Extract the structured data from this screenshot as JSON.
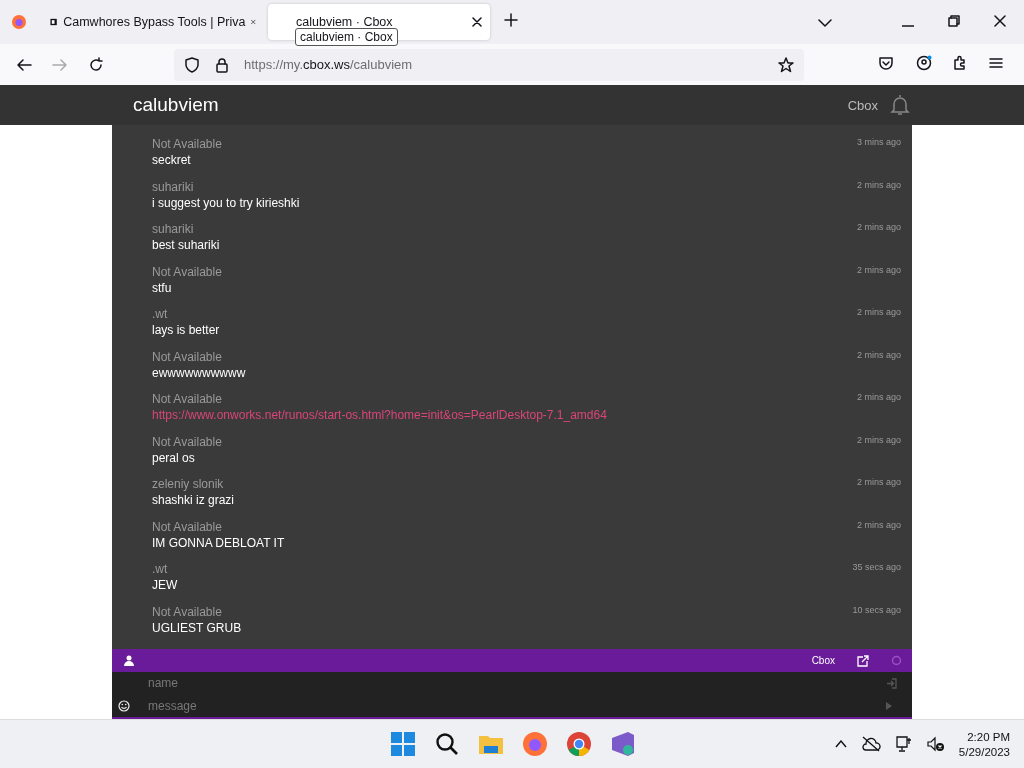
{
  "browser": {
    "tabs": [
      {
        "title": "Camwhores Bypass Tools | Priva",
        "selected": false
      },
      {
        "title": "calubviem · Cbox",
        "selected": true
      }
    ],
    "tooltip": "calubviem · Cbox",
    "url": {
      "prefix": "https://my.",
      "domain": "cbox.ws",
      "path": "/calubviem"
    }
  },
  "header": {
    "title": "calubviem",
    "link": "Cbox"
  },
  "messages": [
    {
      "user": "Not Available",
      "time": "3 mins ago",
      "text": "seckret",
      "kind": "text"
    },
    {
      "user": "suhariki",
      "time": "2 mins ago",
      "text": "i suggest you to try kirieshki",
      "kind": "text"
    },
    {
      "user": "suhariki",
      "time": "2 mins ago",
      "text": "best suhariki",
      "kind": "text"
    },
    {
      "user": "Not Available",
      "time": "2 mins ago",
      "text": "stfu",
      "kind": "text"
    },
    {
      "user": ".wt",
      "time": "2 mins ago",
      "text": "lays is better",
      "kind": "text"
    },
    {
      "user": "Not Available",
      "time": "2 mins ago",
      "text": "ewwwwwwwwww",
      "kind": "text"
    },
    {
      "user": "Not Available",
      "time": "2 mins ago",
      "text": "https://www.onworks.net/runos/start-os.html?home=init&os=PearlDesktop-7.1_amd64",
      "kind": "link"
    },
    {
      "user": "Not Available",
      "time": "2 mins ago",
      "text": "peral os",
      "kind": "text"
    },
    {
      "user": "zeleniy slonik",
      "time": "2 mins ago",
      "text": "shashki iz grazi",
      "kind": "text"
    },
    {
      "user": "Not Available",
      "time": "2 mins ago",
      "text": "IM GONNA DEBLOAT IT",
      "kind": "text"
    },
    {
      "user": ".wt",
      "time": "35 secs ago",
      "text": "JEW",
      "kind": "text"
    },
    {
      "user": "Not Available",
      "time": "10 secs ago",
      "text": "UGLIEST GRUB",
      "kind": "text"
    }
  ],
  "footer": {
    "brand": "Cbox",
    "name_placeholder": "name",
    "message_placeholder": "message"
  },
  "taskbar": {
    "time": "2:20 PM",
    "date": "5/29/2023"
  }
}
